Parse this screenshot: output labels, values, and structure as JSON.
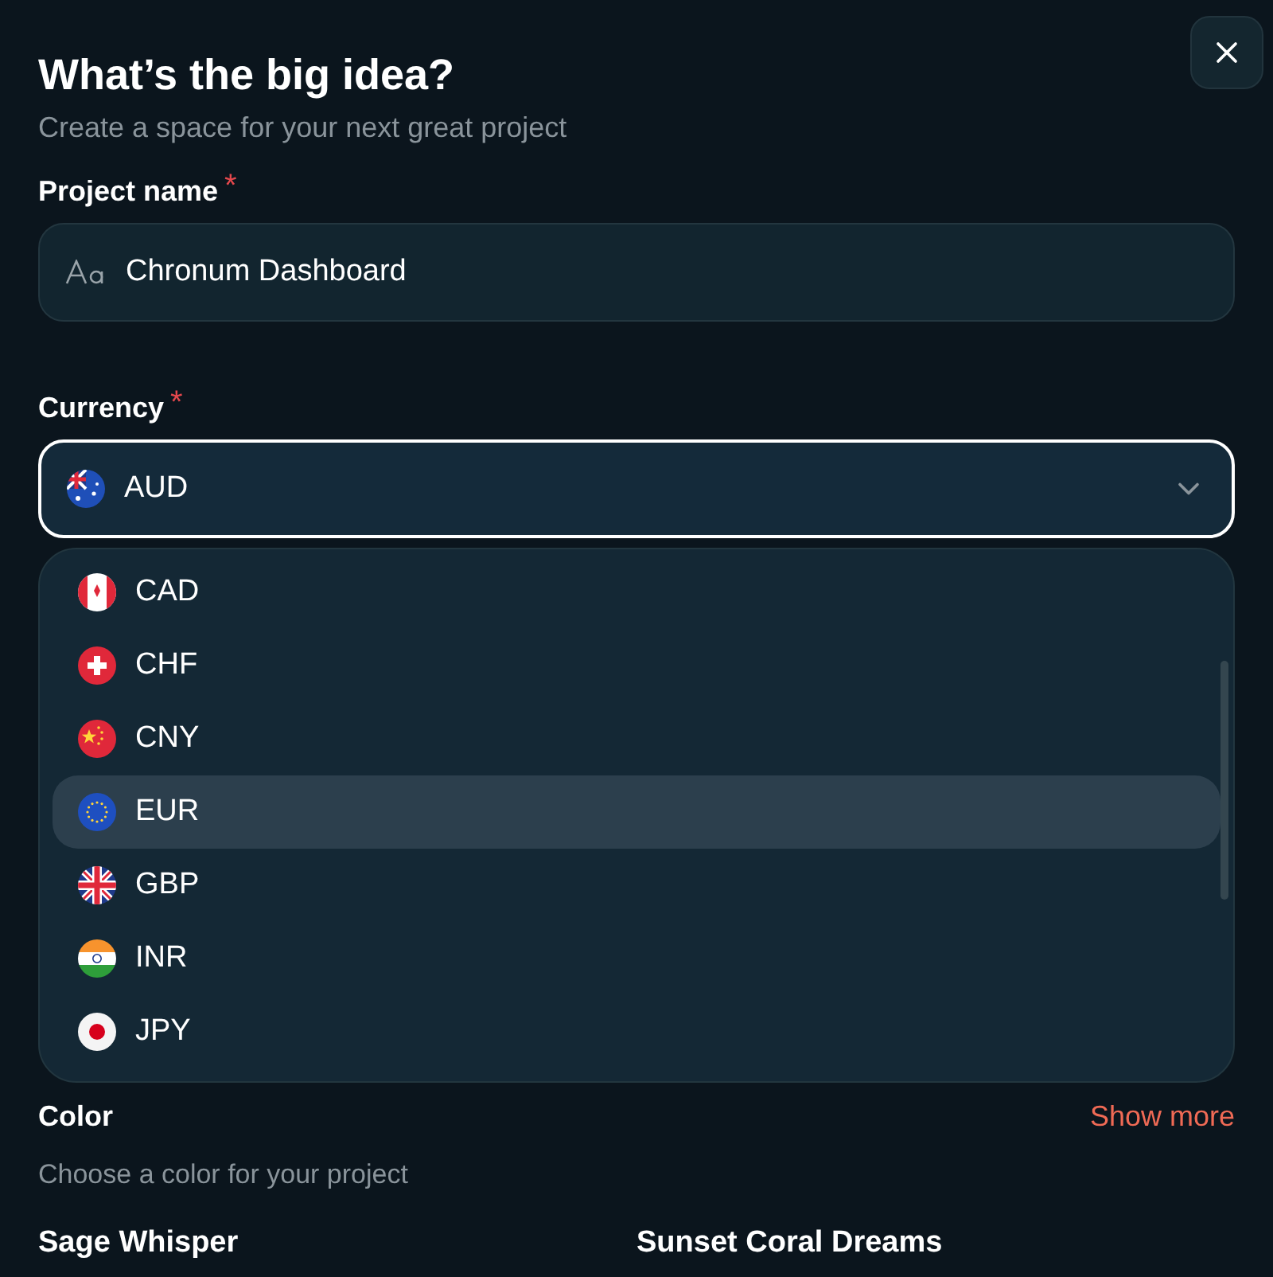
{
  "dialog": {
    "title": "What’s the big idea?",
    "subtitle": "Create a space for your next great project"
  },
  "project_name": {
    "label": "Project name",
    "required_mark": "*",
    "value": "Chronum Dashboard"
  },
  "currency": {
    "label": "Currency",
    "required_mark": "*",
    "current": {
      "label": "AUD",
      "kind": "australia"
    },
    "expanded": true,
    "options": [
      {
        "label": "CAD",
        "kind": "canada",
        "selected": false
      },
      {
        "label": "CHF",
        "kind": "switzerland",
        "selected": false
      },
      {
        "label": "CNY",
        "kind": "china",
        "selected": false
      },
      {
        "label": "EUR",
        "kind": "europe",
        "selected": true
      },
      {
        "label": "GBP",
        "kind": "britain",
        "selected": false
      },
      {
        "label": "INR",
        "kind": "india",
        "selected": false
      },
      {
        "label": "JPY",
        "kind": "japan",
        "selected": false
      }
    ]
  },
  "color": {
    "label": "Color",
    "show_more": "Show more",
    "description": "Choose a color for your project",
    "options": [
      {
        "name": "Sage Whisper"
      },
      {
        "name": "Sunset Coral Dreams"
      }
    ]
  }
}
